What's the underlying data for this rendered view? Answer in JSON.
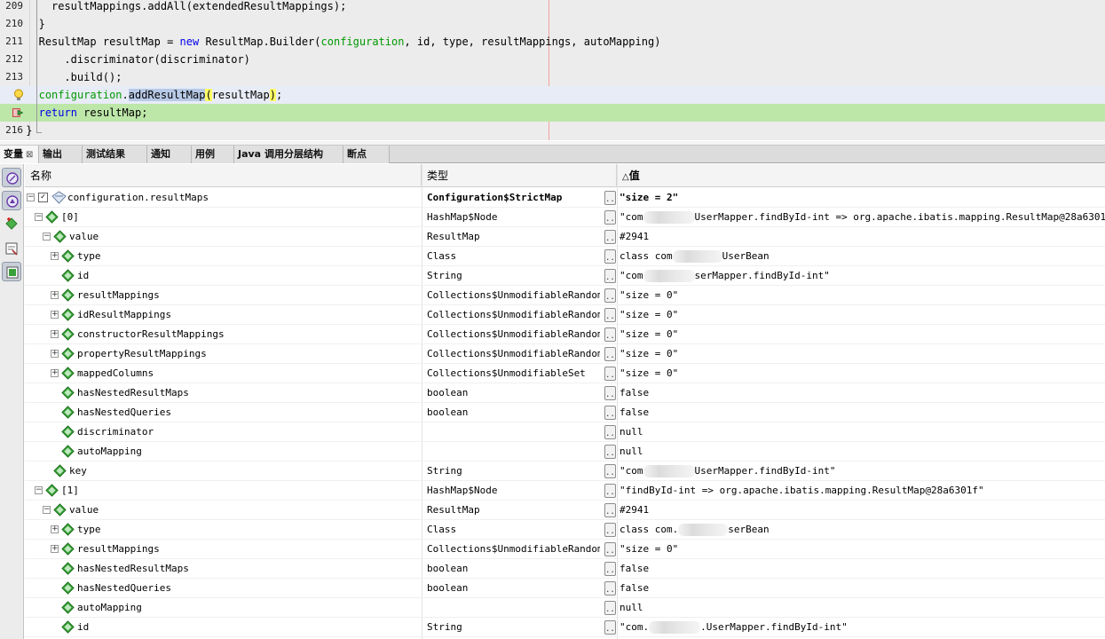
{
  "editor": {
    "lines": [
      {
        "num": "209",
        "indent": "    ",
        "tokens": [
          {
            "t": "resultMappings.addAll(extendedResultMappings);"
          }
        ]
      },
      {
        "num": "210",
        "indent": "  ",
        "tokens": [
          {
            "t": "}"
          }
        ]
      },
      {
        "num": "211",
        "indent": "  ",
        "tokens": [
          {
            "t": "ResultMap resultMap = "
          },
          {
            "t": "new",
            "c": "kw"
          },
          {
            "t": " ResultMap.Builder("
          },
          {
            "t": "configuration",
            "c": "fld"
          },
          {
            "t": ", id, type, resultMappings, autoMapping)"
          }
        ]
      },
      {
        "num": "212",
        "indent": "      ",
        "tokens": [
          {
            "t": ".discriminator(discriminator)"
          }
        ]
      },
      {
        "num": "213",
        "indent": "      ",
        "tokens": [
          {
            "t": ".build();"
          }
        ]
      },
      {
        "num": "",
        "indent": "  ",
        "tokens": [
          {
            "t": "configuration",
            "c": "fld"
          },
          {
            "t": "."
          },
          {
            "t": "addResultMap",
            "c": "sel"
          },
          {
            "t": "(",
            "c": "brk"
          },
          {
            "t": "resultMap"
          },
          {
            "t": ")",
            "c": "brk"
          },
          {
            "t": ";"
          }
        ]
      },
      {
        "num": "",
        "indent": "  ",
        "tokens": [
          {
            "t": "return",
            "c": "kw"
          },
          {
            "t": " resultMap;"
          }
        ]
      },
      {
        "num": "216",
        "indent": "",
        "tokens": [
          {
            "t": "}"
          }
        ]
      }
    ]
  },
  "tabs": [
    {
      "label": "变量",
      "close": "⊠"
    },
    {
      "label": "输出"
    },
    {
      "label": "测试结果"
    },
    {
      "label": "通知"
    },
    {
      "label": "用例"
    },
    {
      "label": "Java 调用分层结构"
    },
    {
      "label": "断点"
    }
  ],
  "table": {
    "columns": {
      "name": "名称",
      "type": "类型",
      "value": "值",
      "sort_indicator": "△"
    },
    "rows": [
      {
        "level": 0,
        "expand": "−",
        "checkbox": "✓",
        "icon": "watch",
        "name": "configuration.resultMaps",
        "type": "Configuration$StrictMap",
        "value": "\"size = 2\"",
        "bold": true
      },
      {
        "level": 1,
        "expand": "−",
        "icon": "diamond",
        "name": "[0]",
        "type": "HashMap$Node",
        "value_pre": "\"com",
        "value_post": "UserMapper.findById-int => org.apache.ibatis.mapping.ResultMap@28a6301f\""
      },
      {
        "level": 2,
        "expand": "−",
        "icon": "diamond",
        "name": "value",
        "type": "ResultMap",
        "value": "#2941"
      },
      {
        "level": 3,
        "expand": "+",
        "icon": "diamond",
        "name": "type",
        "type": "Class",
        "value_pre": "class com",
        "value_post": "UserBean"
      },
      {
        "level": 3,
        "expand": "",
        "icon": "diamond",
        "name": "id",
        "type": "String",
        "value_pre": "\"com",
        "value_post": "serMapper.findById-int\""
      },
      {
        "level": 3,
        "expand": "+",
        "icon": "diamond",
        "name": "resultMappings",
        "type": "Collections$UnmodifiableRandom…",
        "value": "\"size = 0\""
      },
      {
        "level": 3,
        "expand": "+",
        "icon": "diamond",
        "name": "idResultMappings",
        "type": "Collections$UnmodifiableRandom…",
        "value": "\"size = 0\""
      },
      {
        "level": 3,
        "expand": "+",
        "icon": "diamond",
        "name": "constructorResultMappings",
        "type": "Collections$UnmodifiableRandom…",
        "value": "\"size = 0\""
      },
      {
        "level": 3,
        "expand": "+",
        "icon": "diamond",
        "name": "propertyResultMappings",
        "type": "Collections$UnmodifiableRandom…",
        "value": "\"size = 0\""
      },
      {
        "level": 3,
        "expand": "+",
        "icon": "diamond",
        "name": "mappedColumns",
        "type": "Collections$UnmodifiableSet",
        "value": "\"size = 0\""
      },
      {
        "level": 3,
        "expand": "",
        "icon": "diamond",
        "name": "hasNestedResultMaps",
        "type": "boolean",
        "value": "false"
      },
      {
        "level": 3,
        "expand": "",
        "icon": "diamond",
        "name": "hasNestedQueries",
        "type": "boolean",
        "value": "false"
      },
      {
        "level": 3,
        "expand": "",
        "icon": "diamond",
        "name": "discriminator",
        "type": "",
        "value": "null"
      },
      {
        "level": 3,
        "expand": "",
        "icon": "diamond",
        "name": "autoMapping",
        "type": "",
        "value": "null"
      },
      {
        "level": 2,
        "expand": "",
        "icon": "diamond",
        "name": "key",
        "type": "String",
        "value_pre": "\"com",
        "value_post": "UserMapper.findById-int\""
      },
      {
        "level": 1,
        "expand": "−",
        "icon": "diamond",
        "name": "[1]",
        "type": "HashMap$Node",
        "value": "\"findById-int => org.apache.ibatis.mapping.ResultMap@28a6301f\""
      },
      {
        "level": 2,
        "expand": "−",
        "icon": "diamond",
        "name": "value",
        "type": "ResultMap",
        "value": "#2941"
      },
      {
        "level": 3,
        "expand": "+",
        "icon": "diamond",
        "name": "type",
        "type": "Class",
        "value_pre": "class com.",
        "value_post": "serBean"
      },
      {
        "level": 3,
        "expand": "+",
        "icon": "diamond",
        "name": "resultMappings",
        "type": "Collections$UnmodifiableRandom…",
        "value": "\"size = 0\""
      },
      {
        "level": 3,
        "expand": "",
        "icon": "diamond",
        "name": "hasNestedResultMaps",
        "type": "boolean",
        "value": "false"
      },
      {
        "level": 3,
        "expand": "",
        "icon": "diamond",
        "name": "hasNestedQueries",
        "type": "boolean",
        "value": "false"
      },
      {
        "level": 3,
        "expand": "",
        "icon": "diamond",
        "name": "autoMapping",
        "type": "",
        "value": "null"
      },
      {
        "level": 3,
        "expand": "",
        "icon": "diamond",
        "name": "id",
        "type": "String",
        "value_pre": "\"com.",
        "value_post": ".UserMapper.findById-int\""
      }
    ]
  },
  "colors": {
    "diamond": "#2e9a2e",
    "current_line": "#e8ecf6",
    "hit_line": "#bde6a9",
    "keyword": "#0000e6",
    "field": "#009900"
  }
}
